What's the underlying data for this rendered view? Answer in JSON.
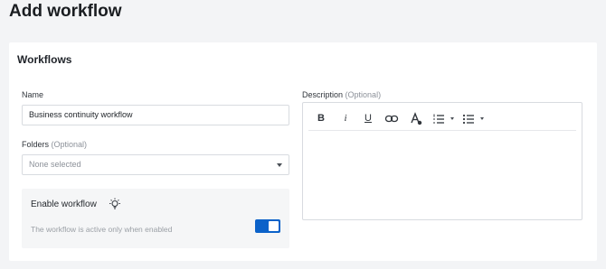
{
  "page": {
    "title": "Add workflow"
  },
  "card": {
    "title": "Workflows"
  },
  "name": {
    "label": "Name",
    "value": "Business continuity workflow"
  },
  "folders": {
    "label": "Folders",
    "optional": "(Optional)",
    "value": "None selected"
  },
  "description": {
    "label": "Description",
    "optional": "(Optional)",
    "value": ""
  },
  "enable": {
    "title": "Enable workflow",
    "hint": "The workflow is active only when enabled",
    "enabled": true,
    "accent": "#0b62c9"
  },
  "toolbar": {
    "bold": "B",
    "italic": "i",
    "underline": "U",
    "icons": [
      "bold-icon",
      "italic-icon",
      "underline-icon",
      "link-icon",
      "text-color-icon",
      "numbered-list-icon",
      "bulleted-list-icon"
    ]
  }
}
